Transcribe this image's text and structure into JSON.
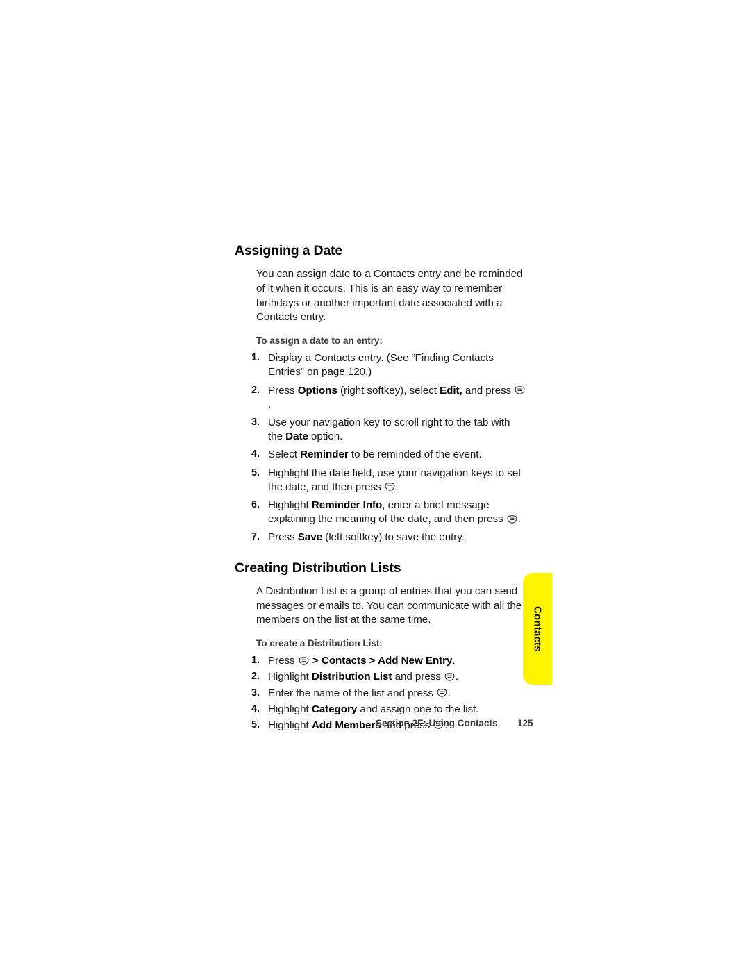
{
  "page": {
    "background_color": "#ffffff",
    "text_color": "#1a1a1a"
  },
  "thumb_tab": {
    "label": "Contacts",
    "color": "#FFF500"
  },
  "sections": [
    {
      "heading": "Assigning a Date",
      "intro": "You can assign date to a Contacts entry and be reminded of it when it occurs. This is an easy way to remember birthdays or another important date associated with a Contacts entry.",
      "lead_in": "To assign a date to an entry:",
      "steps": [
        {
          "num": "1.",
          "text": "Display a Contacts entry. (See “Finding Contacts Entries” on page 120.)"
        },
        {
          "num": "2.",
          "text": "Press Options (right softkey), select Edit, and press [OK key]."
        },
        {
          "num": "3.",
          "text": "Use your navigation key to scroll right to the tab with the Date option."
        },
        {
          "num": "4.",
          "text": "Select Reminder to be reminded of the event."
        },
        {
          "num": "5.",
          "text": "Highlight the date field, use your navigation keys to set the date, and then press [OK key]."
        },
        {
          "num": "6.",
          "text": "Highlight Reminder Info, enter a brief message explaining the meaning of the date, and then press [OK key]."
        },
        {
          "num": "7.",
          "text": "Press Save (left softkey) to save the entry."
        }
      ]
    },
    {
      "heading": "Creating Distribution Lists",
      "intro": "A Distribution List is a group of entries that you can send messages or emails to. You can communicate with all the members on the list at the same time.",
      "lead_in": "To create a Distribution List:",
      "steps": [
        {
          "num": "1.",
          "text": "Press [OK key] > Contacts > Add New Entry."
        },
        {
          "num": "2.",
          "text": "Highlight Distribution List and press [OK key]."
        },
        {
          "num": "3.",
          "text": "Enter the name of the list and press [OK key]."
        },
        {
          "num": "4.",
          "text": "Highlight Category and assign one to the list."
        },
        {
          "num": "5.",
          "text": "Highlight Add Members and press [OK key]."
        }
      ]
    }
  ],
  "footer": {
    "section": "Section 2F: Using Contacts",
    "page_number": "125"
  }
}
